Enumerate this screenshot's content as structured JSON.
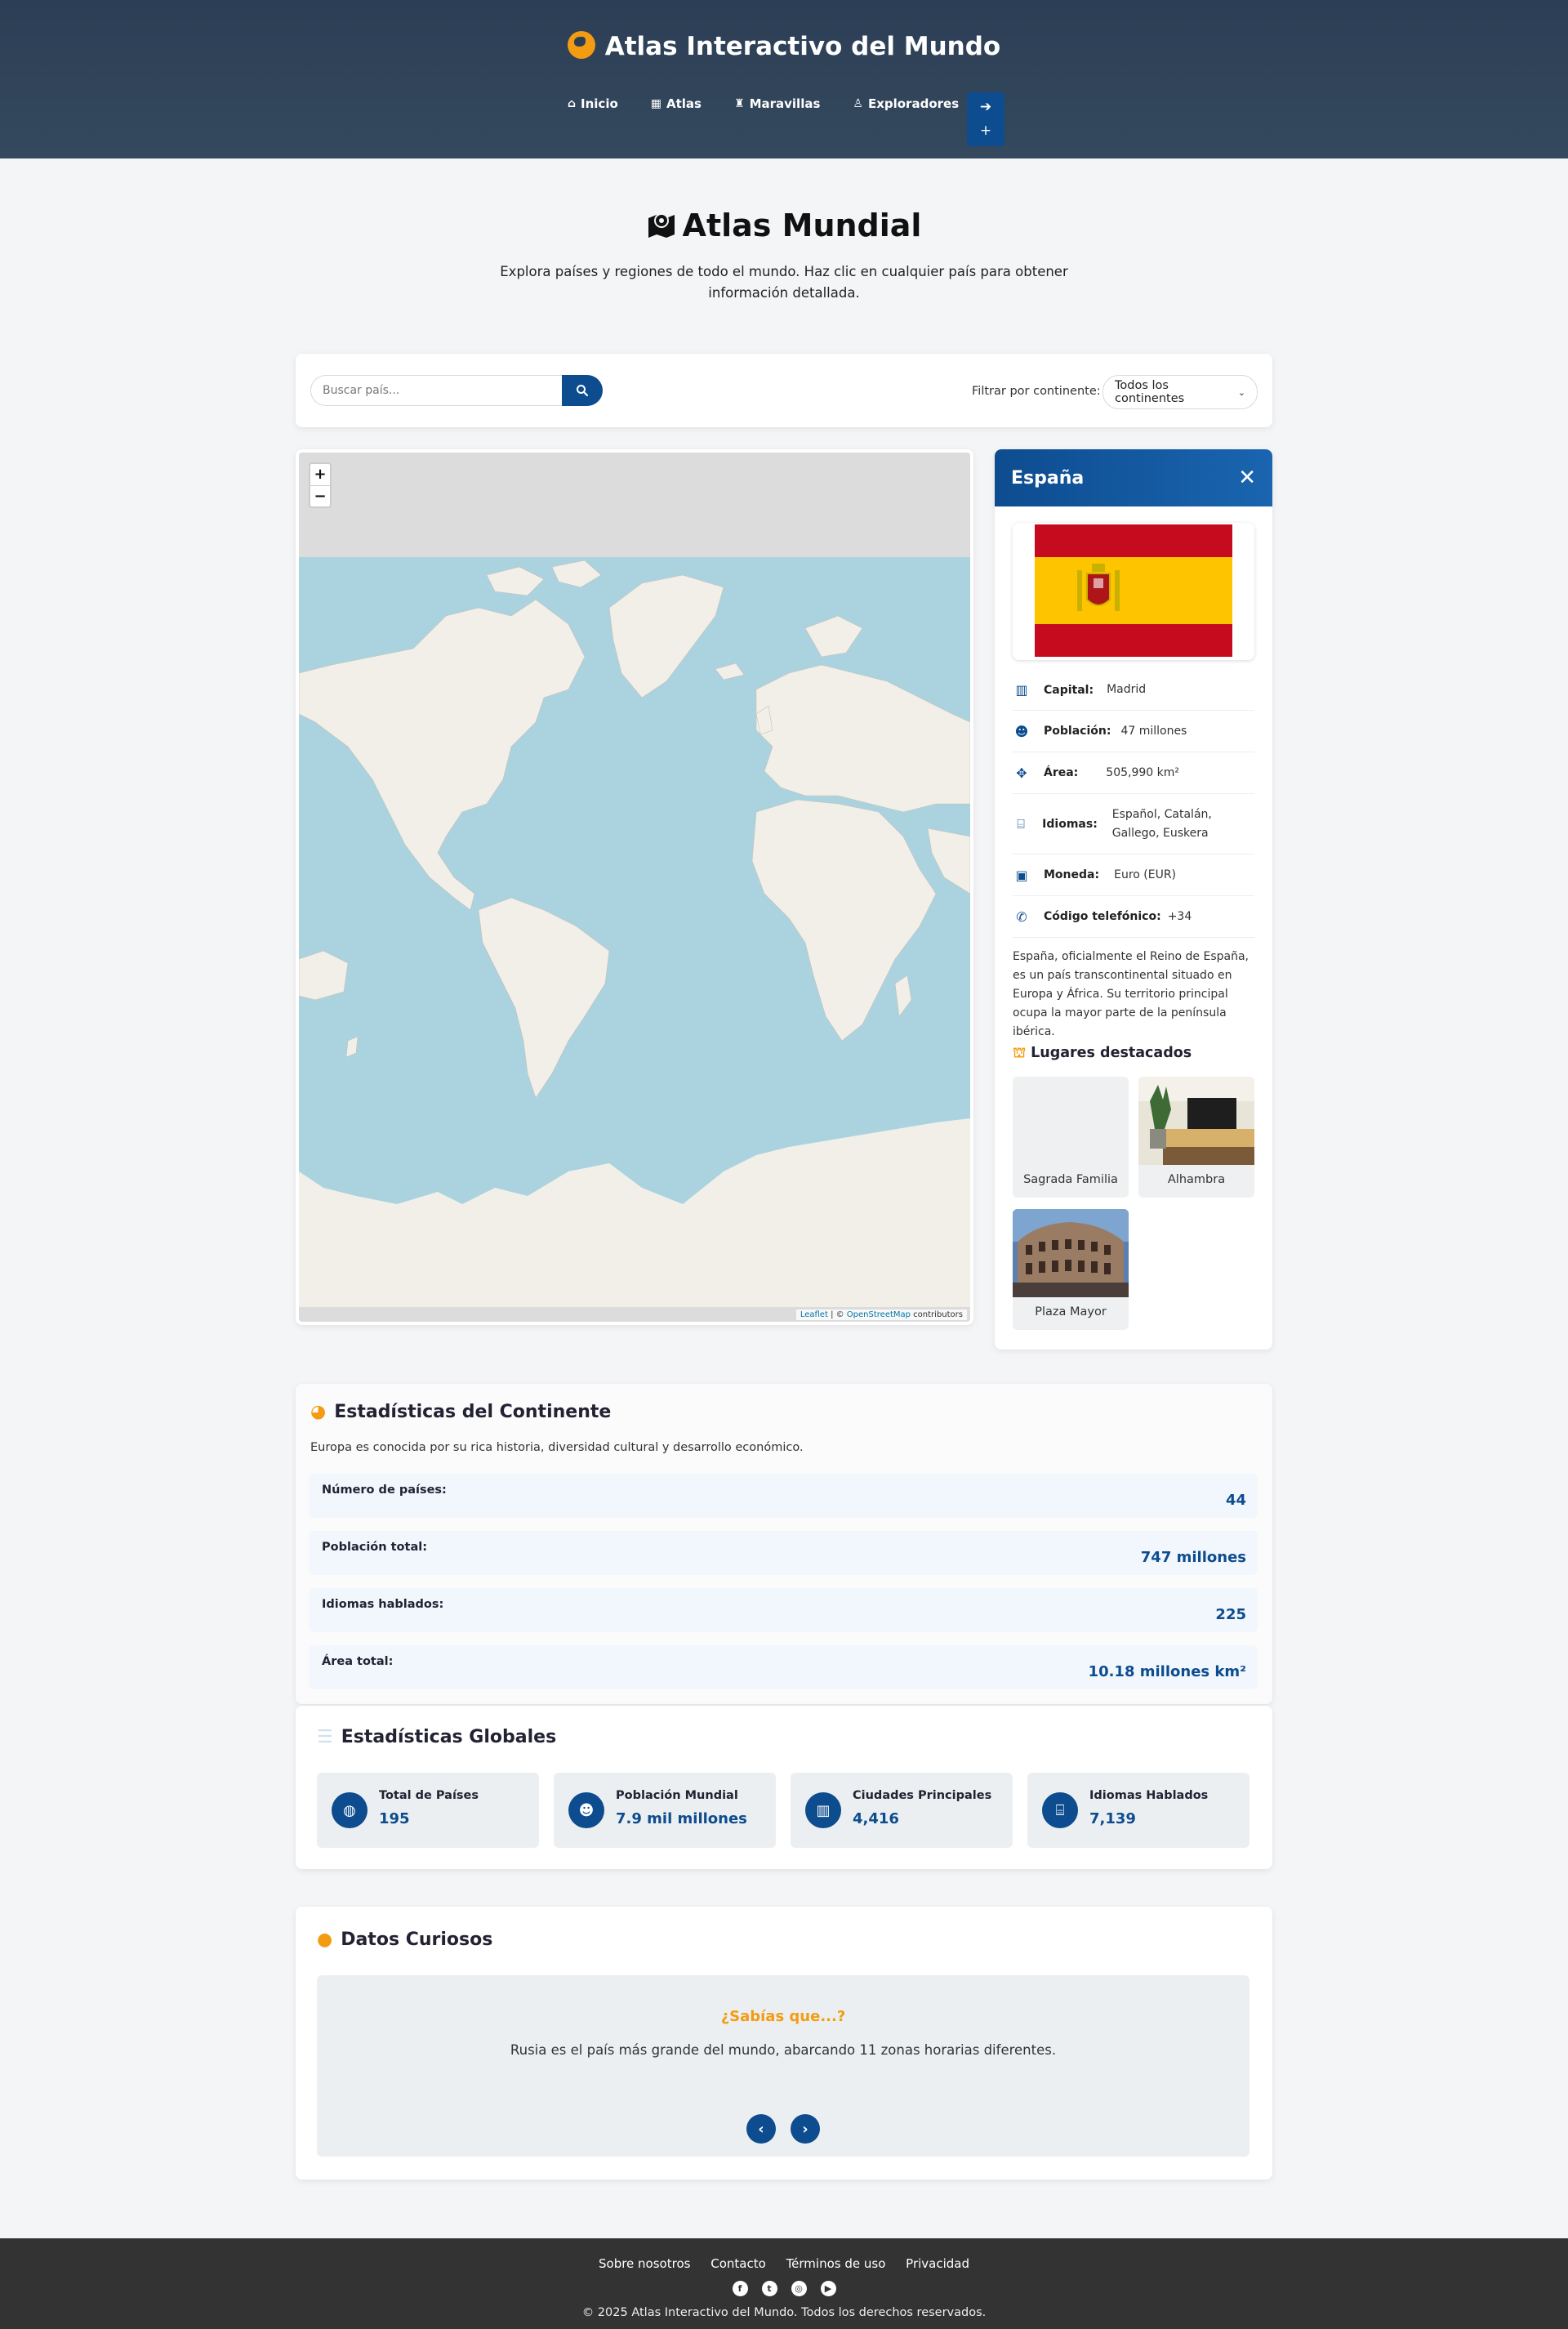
{
  "header": {
    "brand": "Atlas Interactivo del Mundo",
    "nav": [
      {
        "label": "Inicio",
        "icon": "home-icon"
      },
      {
        "label": "Atlas",
        "icon": "map-icon"
      },
      {
        "label": "Maravillas",
        "icon": "monument-icon"
      },
      {
        "label": "Exploradores",
        "icon": "hiker-icon"
      }
    ],
    "auth_icons": [
      "login-icon",
      "user-plus-icon"
    ]
  },
  "page": {
    "title": "Atlas Mundial",
    "subtitle": "Explora países y regiones de todo el mundo. Haz clic en cualquier país para obtener información detallada."
  },
  "search": {
    "placeholder": "Buscar país...",
    "filter_label": "Filtrar por continente:",
    "filter_value": "Todos los continentes"
  },
  "map": {
    "zoom_in": "+",
    "zoom_out": "−",
    "attr_leaflet": "Leaflet",
    "attr_sep": " | © ",
    "attr_osm": "OpenStreetMap",
    "attr_suffix": " contributors",
    "colors": {
      "ocean": "#aad3df",
      "land": "#f2efe9",
      "tile_bg": "#dcdcdc"
    }
  },
  "country": {
    "name": "España",
    "close": "✕",
    "rows": [
      {
        "icon": "city-icon",
        "label": "Capital:",
        "value": "Madrid"
      },
      {
        "icon": "people-icon",
        "label": "Población:",
        "value": "47 millones"
      },
      {
        "icon": "area-icon",
        "label": "Área:",
        "value": "505,990 km²"
      },
      {
        "icon": "language-icon",
        "label": "Idiomas:",
        "value": "Español, Catalán, Gallego, Euskera"
      },
      {
        "icon": "money-icon",
        "label": "Moneda:",
        "value": "Euro (EUR)"
      },
      {
        "icon": "phone-icon",
        "label": "Código telefónico:",
        "value": "+34"
      }
    ],
    "description": "España, oficialmente el Reino de España, es un país transcontinental situado en Europa y África. Su territorio principal ocupa la mayor parte de la península ibérica.",
    "places_title": "Lugares destacados",
    "places": [
      {
        "name": "Sagrada Familia"
      },
      {
        "name": "Alhambra"
      },
      {
        "name": "Plaza Mayor"
      }
    ],
    "flag_colors": {
      "red": "#c60b1e",
      "yellow": "#ffc400"
    }
  },
  "continent": {
    "title": "Estadísticas del Continente",
    "description": "Europa es conocida por su rica historia, diversidad cultural y desarrollo económico.",
    "stats": [
      {
        "label": "Número de países:",
        "value": "44"
      },
      {
        "label": "Población total:",
        "value": "747 millones"
      },
      {
        "label": "Idiomas hablados:",
        "value": "225"
      },
      {
        "label": "Área total:",
        "value": "10.18 millones km²"
      }
    ]
  },
  "global": {
    "title": "Estadísticas Globales",
    "items": [
      {
        "label": "Total de Países",
        "value": "195",
        "icon": "globe-icon"
      },
      {
        "label": "Población Mundial",
        "value": "7.9 mil millones",
        "icon": "people-icon"
      },
      {
        "label": "Ciudades Principales",
        "value": "4,416",
        "icon": "city-icon"
      },
      {
        "label": "Idiomas Hablados",
        "value": "7,139",
        "icon": "language-icon"
      }
    ]
  },
  "facts": {
    "title": "Datos Curiosos",
    "question": "¿Sabías que...?",
    "text": "Rusia es el país más grande del mundo, abarcando 11 zonas horarias diferentes.",
    "prev": "‹",
    "next": "›"
  },
  "footer": {
    "links": [
      "Sobre nosotros",
      "Contacto",
      "Términos de uso",
      "Privacidad"
    ],
    "social": [
      "facebook-icon",
      "twitter-icon",
      "instagram-icon",
      "youtube-icon"
    ],
    "copyright": "© 2025 Atlas Interactivo del Mundo. Todos los derechos reservados."
  },
  "colors": {
    "primary": "#0d4c8f",
    "accent": "#f39c12",
    "header_bg": "#2c3e55",
    "footer_bg": "#333333"
  }
}
